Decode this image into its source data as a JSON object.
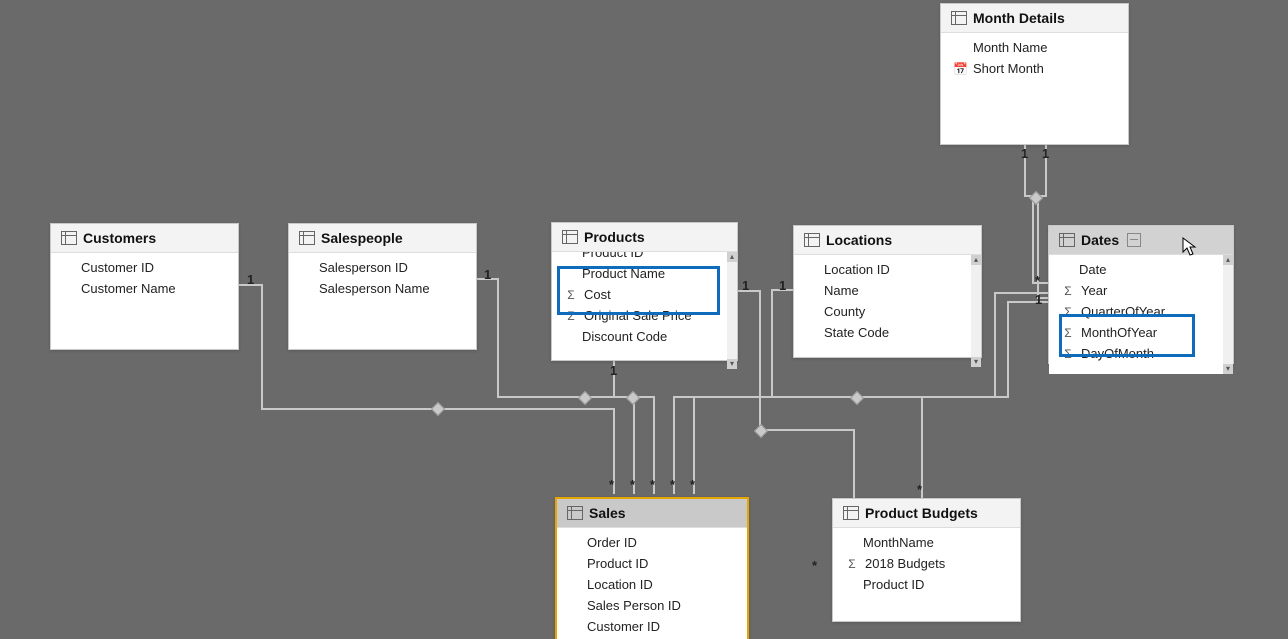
{
  "tables": {
    "monthDetails": {
      "title": "Month Details",
      "fields": [
        {
          "label": "Month Name",
          "icon": ""
        },
        {
          "label": "Short Month",
          "icon": "date"
        }
      ]
    },
    "customers": {
      "title": "Customers",
      "fields": [
        {
          "label": "Customer ID"
        },
        {
          "label": "Customer Name"
        }
      ]
    },
    "salespeople": {
      "title": "Salespeople",
      "fields": [
        {
          "label": "Salesperson ID"
        },
        {
          "label": "Salesperson Name"
        }
      ]
    },
    "products": {
      "title": "Products",
      "fields": [
        {
          "label": "Product ID"
        },
        {
          "label": "Product Name"
        },
        {
          "label": "Cost",
          "icon": "sigma"
        },
        {
          "label": "Original Sale Price",
          "icon": "sigma"
        },
        {
          "label": "Discount Code"
        }
      ]
    },
    "locations": {
      "title": "Locations",
      "fields": [
        {
          "label": "Location ID"
        },
        {
          "label": "Name"
        },
        {
          "label": "County"
        },
        {
          "label": "State Code"
        }
      ]
    },
    "dates": {
      "title": "Dates",
      "fields": [
        {
          "label": "Date"
        },
        {
          "label": "Year",
          "icon": "sigma"
        },
        {
          "label": "QuarterOfYear",
          "icon": "sigma"
        },
        {
          "label": "MonthOfYear",
          "icon": "sigma"
        },
        {
          "label": "DayOfMonth",
          "icon": "sigma"
        }
      ]
    },
    "sales": {
      "title": "Sales",
      "fields": [
        {
          "label": "Order ID"
        },
        {
          "label": "Product ID"
        },
        {
          "label": "Location ID"
        },
        {
          "label": "Sales Person ID"
        },
        {
          "label": "Customer ID"
        }
      ]
    },
    "productBudgets": {
      "title": "Product Budgets",
      "fields": [
        {
          "label": "MonthName"
        },
        {
          "label": "2018 Budgets",
          "icon": "sigma"
        },
        {
          "label": "Product ID"
        }
      ]
    }
  },
  "cardinality": {
    "c1": "1",
    "c2": "1",
    "c3": "1",
    "c4": "1",
    "c5": "1",
    "c6": "1",
    "c7": "*",
    "c8": "*",
    "c9": "*",
    "c10": "*",
    "c11": "*",
    "c12": "*",
    "c13": "*",
    "c14": "*",
    "c15": "*",
    "c16": "1",
    "c17": "1",
    "c18": "1"
  }
}
